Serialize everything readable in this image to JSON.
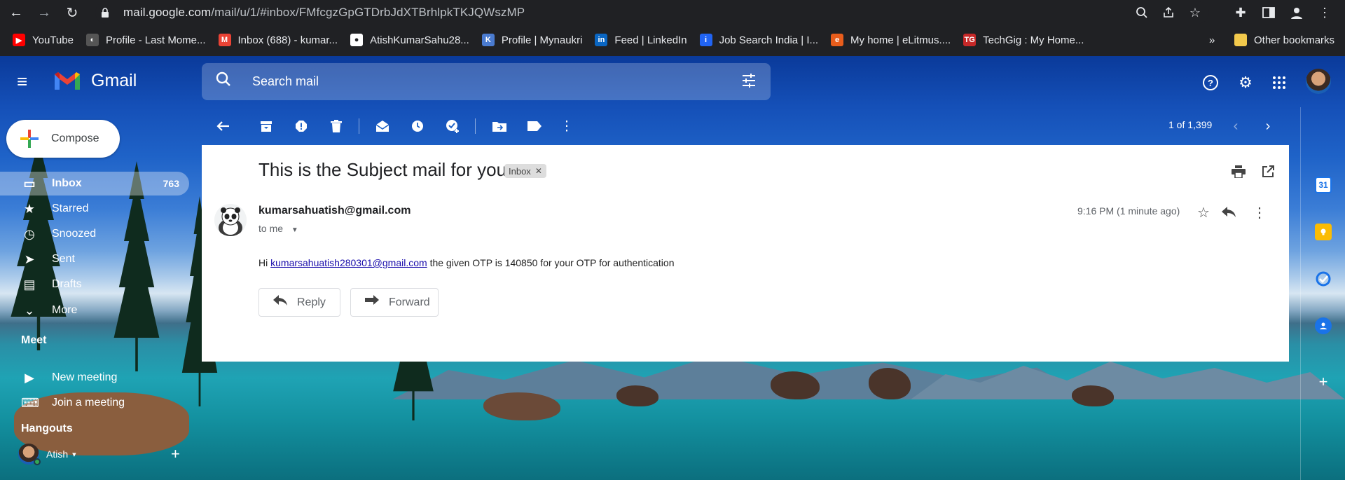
{
  "browser": {
    "url_host": "mail.google.com",
    "url_path": "/mail/u/1/#inbox/FMfcgzGpGTDrbJdXTBrhlpkTKJQWszMP",
    "bookmarks": [
      {
        "label": "YouTube",
        "color": "#ff0000",
        "glyph": "▶"
      },
      {
        "label": "Profile - Last Mome...",
        "color": "#555555",
        "glyph": "◐"
      },
      {
        "label": "Inbox (688) - kumar...",
        "color": "#ea4335",
        "glyph": "M"
      },
      {
        "label": "AtishKumarSahu28...",
        "color": "#ffffff",
        "glyph": "●"
      },
      {
        "label": "Profile | Mynaukri",
        "color": "#4a7bd0",
        "glyph": "K"
      },
      {
        "label": "Feed | LinkedIn",
        "color": "#0a66c2",
        "glyph": "in"
      },
      {
        "label": "Job Search India | I...",
        "color": "#2164f3",
        "glyph": "i"
      },
      {
        "label": "My home | eLitmus....",
        "color": "#e85d1c",
        "glyph": "e"
      },
      {
        "label": "TechGig : My Home...",
        "color": "#c62828",
        "glyph": "TG"
      }
    ],
    "bookmarks_more": "»",
    "other_bookmarks": "Other bookmarks"
  },
  "gmail": {
    "app_name": "Gmail",
    "search_placeholder": "Search mail",
    "compose_label": "Compose",
    "nav": [
      {
        "label": "Inbox",
        "icon": "inbox-icon",
        "glyph": "▭",
        "count": "763",
        "active": true
      },
      {
        "label": "Starred",
        "icon": "star-icon",
        "glyph": "★",
        "count": ""
      },
      {
        "label": "Snoozed",
        "icon": "clock-icon",
        "glyph": "◷",
        "count": ""
      },
      {
        "label": "Sent",
        "icon": "send-icon",
        "glyph": "➤",
        "count": ""
      },
      {
        "label": "Drafts",
        "icon": "draft-icon",
        "glyph": "▤",
        "count": ""
      },
      {
        "label": "More",
        "icon": "chevron-down-icon",
        "glyph": "⌄",
        "count": ""
      }
    ],
    "meet": {
      "heading": "Meet",
      "items": [
        {
          "label": "New meeting",
          "icon": "video-icon",
          "glyph": "▶"
        },
        {
          "label": "Join a meeting",
          "icon": "keyboard-icon",
          "glyph": "⌨"
        }
      ]
    },
    "hangouts": {
      "heading": "Hangouts",
      "user": "Atish",
      "user_caret": "▾"
    },
    "pager": "1 of 1,399",
    "message": {
      "subject": "This is the Subject mail for you.",
      "label": "Inbox",
      "sender": "kumarsahuatish@gmail.com",
      "to": "to me",
      "time": "9:16 PM (1 minute ago)",
      "body_prefix": "Hi ",
      "body_link": "kumarsahuatish280301@gmail.com",
      "body_suffix": " the given OTP is 140850 for your OTP for authentication",
      "reply_label": "Reply",
      "forward_label": "Forward"
    }
  },
  "colors": {
    "accent_blue": "#1a73e8",
    "chrome_bg": "#202124"
  }
}
